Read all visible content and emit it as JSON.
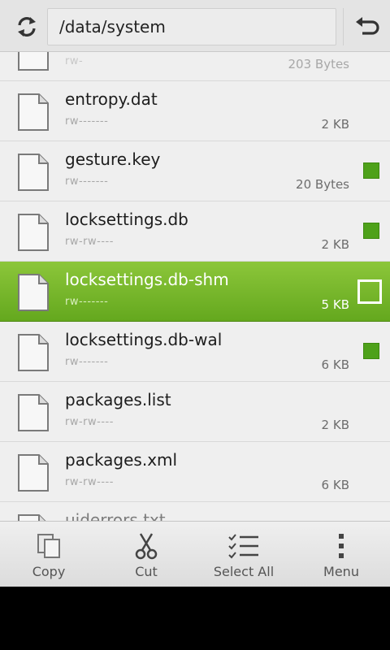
{
  "header": {
    "path": "/data/system",
    "refresh_icon": "refresh-icon",
    "back_icon": "back-arrow-icon"
  },
  "files": [
    {
      "name": "",
      "perm": "rw-",
      "size": "203 Bytes",
      "checked": false,
      "selected": false,
      "partial": true
    },
    {
      "name": "entropy.dat",
      "perm": "rw-------",
      "size": "2 KB",
      "checked": false,
      "selected": false
    },
    {
      "name": "gesture.key",
      "perm": "rw-------",
      "size": "20 Bytes",
      "checked": true,
      "selected": false
    },
    {
      "name": "locksettings.db",
      "perm": "rw-rw----",
      "size": "2 KB",
      "checked": true,
      "selected": false
    },
    {
      "name": "locksettings.db-shm",
      "perm": "rw-------",
      "size": "5 KB",
      "checked": false,
      "selected": true
    },
    {
      "name": "locksettings.db-wal",
      "perm": "rw-------",
      "size": "6 KB",
      "checked": true,
      "selected": false
    },
    {
      "name": "packages.list",
      "perm": "rw-rw----",
      "size": "2 KB",
      "checked": false,
      "selected": false
    },
    {
      "name": "packages.xml",
      "perm": "rw-rw----",
      "size": "6 KB",
      "checked": false,
      "selected": false
    },
    {
      "name": "uiderrors.txt",
      "perm": "",
      "size": "",
      "checked": false,
      "selected": false,
      "partial": true
    }
  ],
  "toolbar": {
    "copy_label": "Copy",
    "cut_label": "Cut",
    "select_all_label": "Select All",
    "menu_label": "Menu"
  },
  "colors": {
    "accent": "#64a81e",
    "check": "#4ea11a"
  }
}
